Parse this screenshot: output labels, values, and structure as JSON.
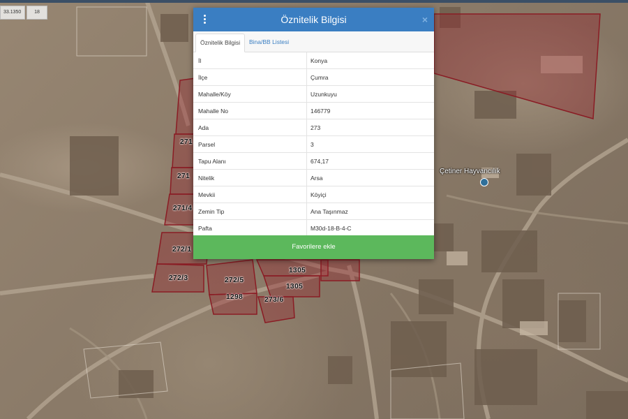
{
  "map": {
    "coord_left": "33.1350",
    "coord_right": "18",
    "place_name": "Çetiner Hayvancılık",
    "parcel_labels": [
      "271",
      "271",
      "271/4",
      "272/1",
      "272/3",
      "272/5",
      "1298",
      "1305",
      "1305",
      "273/6"
    ],
    "parcel_color": "#8a1c24",
    "parcel_fill": "rgba(150,30,40,0.35)"
  },
  "modal": {
    "title": "Öznitelik Bilgisi",
    "close_glyph": "×",
    "tabs": [
      {
        "label": "Öznitelik Bilgisi",
        "active": true
      },
      {
        "label": "Bina/BB Listesi",
        "active": false
      }
    ],
    "rows": [
      {
        "key": "İl",
        "value": "Konya"
      },
      {
        "key": "İlçe",
        "value": "Çumra"
      },
      {
        "key": "Mahalle/Köy",
        "value": "Uzunkuyu"
      },
      {
        "key": "Mahalle No",
        "value": "146779"
      },
      {
        "key": "Ada",
        "value": "273"
      },
      {
        "key": "Parsel",
        "value": "3"
      },
      {
        "key": "Tapu Alanı",
        "value": "674,17"
      },
      {
        "key": "Nitelik",
        "value": "Arsa"
      },
      {
        "key": "Mevkii",
        "value": "Köyiçi"
      },
      {
        "key": "Zemin Tip",
        "value": "Ana Taşınmaz"
      },
      {
        "key": "Pafta",
        "value": "M30d-18-B-4-C"
      }
    ],
    "favorite_button": "Favorilere ekle",
    "header_color": "#3a7ec2",
    "button_color": "#5cb85c"
  }
}
